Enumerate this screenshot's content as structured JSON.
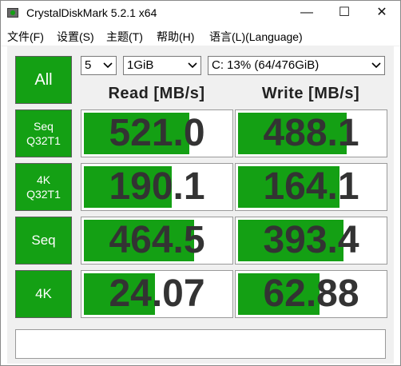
{
  "window": {
    "title": "CrystalDiskMark 5.2.1 x64",
    "minimize": "—",
    "maximize": "☐",
    "close": "✕"
  },
  "menu": [
    "文件(F)",
    "设置(S)",
    "主题(T)",
    "帮助(H)",
    "语言(L)(Language)"
  ],
  "controls": {
    "all_label": "All",
    "count": "5",
    "size": "1GiB",
    "drive": "C: 13% (64/476GiB)"
  },
  "headers": {
    "read": "Read [MB/s]",
    "write": "Write [MB/s]"
  },
  "rows": [
    {
      "label1": "Seq",
      "label2": "Q32T1",
      "read": "521.0",
      "write": "488.1",
      "read_fill": 0.7,
      "write_fill": 0.72
    },
    {
      "label1": "4K",
      "label2": "Q32T1",
      "read": "190.1",
      "write": "164.1",
      "read_fill": 0.58,
      "write_fill": 0.67
    },
    {
      "label1": "Seq",
      "label2": "",
      "read": "464.5",
      "write": "393.4",
      "read_fill": 0.73,
      "write_fill": 0.7
    },
    {
      "label1": "4K",
      "label2": "",
      "read": "24.07",
      "write": "62.88",
      "read_fill": 0.47,
      "write_fill": 0.54
    }
  ],
  "status_text": "",
  "colors": {
    "accent_green": "#14a014",
    "value_text": "#333333"
  }
}
